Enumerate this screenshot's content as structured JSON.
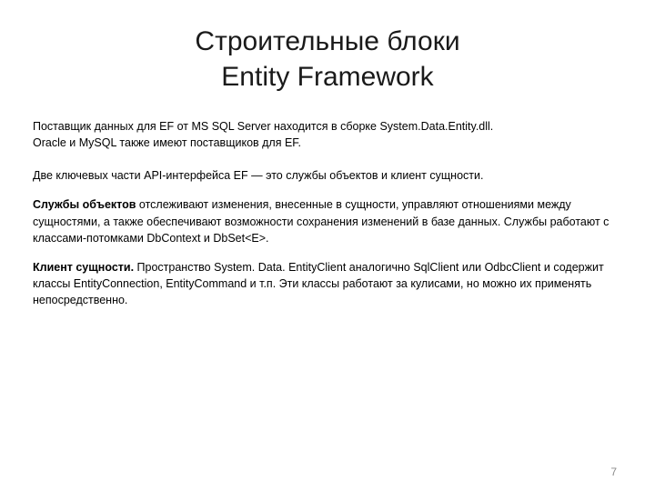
{
  "title_line1": "Строительные блоки",
  "title_line2": "Entity Framework",
  "p1_a": "Поставщик данных для EF от MS SQL Server находится в сборке System.Data.Entity.dll.",
  "p1_b": "Oracle и MySQL также имеют поставщиков для EF.",
  "p2": "Две ключевых части API-интерфейса EF — это службы объектов и клиент сущности.",
  "p3_bold": "Службы объектов",
  "p3_rest": " отслеживают изменения, внесенные в сущности, управляют отношениями между сущностями, а также обеспечивают возможности сохранения изменений в базе данных. Службы работают с классами-потомками DbContext и DbSet<E>.",
  "p4_bold": "Клиент сущности.",
  "p4_rest": " Пространство System. Data. EntityClient аналогично SqlClient или OdbcClient и содержит классы EntityConnection, EntityCommand и т.п. Эти классы работают за кулисами, но можно их применять непосредственно.",
  "page_number": "7"
}
